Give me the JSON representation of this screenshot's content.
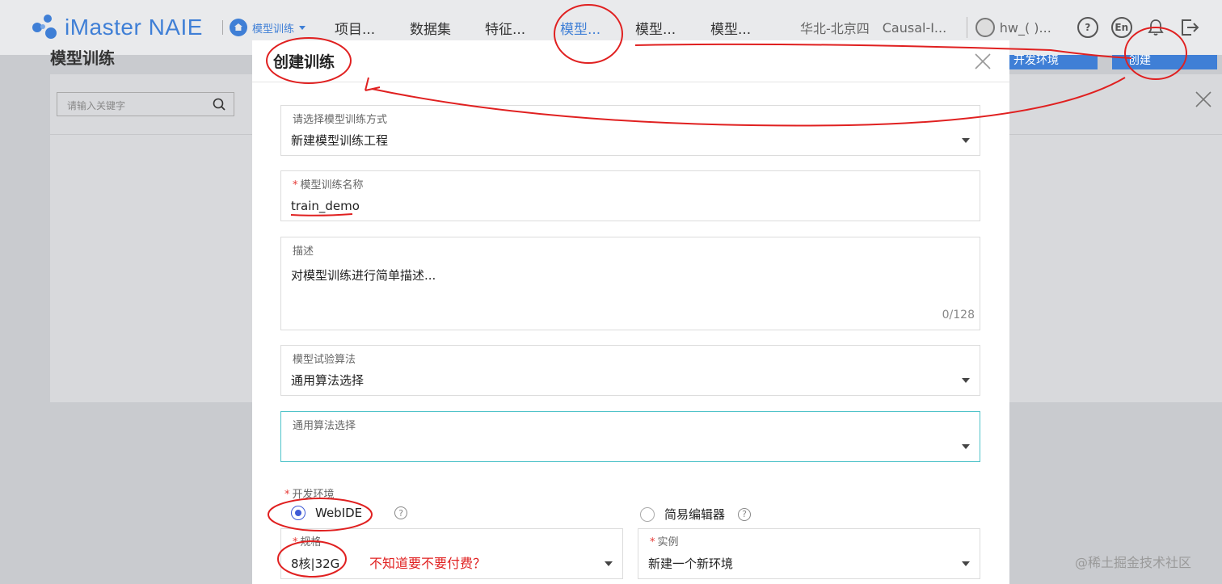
{
  "header": {
    "logo_text": "iMaster NAIE",
    "module_label": "模型训练",
    "nav": [
      "项目...",
      "数据集",
      "特征...",
      "模型...",
      "模型...",
      "模型..."
    ],
    "active_nav_index": 3,
    "region": "华北-北京四",
    "project": "Causal-I...",
    "user": "hw_(                 )...",
    "lang_badge": "En",
    "help_badge": "?"
  },
  "background_page": {
    "title": "模型训练",
    "search_placeholder": "请输入关键字",
    "dev_env_button": "开发环境",
    "create_button": "创建"
  },
  "modal": {
    "title": "创建训练",
    "method": {
      "label": "请选择模型训练方式",
      "value": "新建模型训练工程"
    },
    "name": {
      "label": "模型训练名称",
      "value": "train_demo"
    },
    "description": {
      "label": "描述",
      "placeholder": "对模型训练进行简单描述...",
      "counter": "0/128"
    },
    "algorithm": {
      "label": "模型试验算法",
      "value": "通用算法选择"
    },
    "general_algo": {
      "label": "通用算法选择",
      "value": ""
    },
    "dev_env": {
      "label": "开发环境",
      "options": [
        "WebIDE",
        "简易编辑器"
      ],
      "selected": "WebIDE"
    },
    "spec": {
      "label": "规格",
      "value": "8核|32G"
    },
    "instance": {
      "label": "实例",
      "value": "新建一个新环境"
    }
  },
  "annotation_note": "不知道要不要付费？",
  "watermark": "@稀土掘金技术社区",
  "colors": {
    "accent": "#3f7fd6",
    "annotation": "#e02020",
    "focus": "#4fc3c9"
  }
}
